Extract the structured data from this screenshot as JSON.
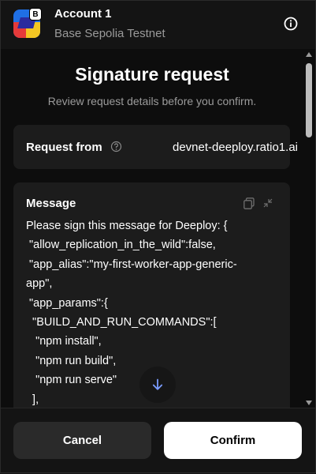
{
  "header": {
    "account_name": "Account 1",
    "network": "Base Sepolia Testnet",
    "avatar_badge": "B"
  },
  "page": {
    "title": "Signature request",
    "subtitle": "Review request details before you confirm."
  },
  "request": {
    "label": "Request from",
    "origin": "devnet-deeploy.ratio1.ai"
  },
  "message": {
    "label": "Message",
    "text": "Please sign this message for Deeploy: {\n \"allow_replication_in_the_wild\":false,\n \"app_alias\":\"my-first-worker-app-generic-\napp\",\n \"app_params\":{\n  \"BUILD_AND_RUN_COMMANDS\":[\n   \"npm install\",\n   \"npm run build\",\n   \"npm run serve\"\n  ],"
  },
  "footer": {
    "cancel_label": "Cancel",
    "confirm_label": "Confirm"
  },
  "colors": {
    "background": "#0d0d0d",
    "card": "#1c1c1c",
    "confirm_bg": "#ffffff",
    "cancel_bg": "#2a2a2a",
    "accent_arrow": "#7a9cff"
  },
  "icons": [
    "info-icon",
    "help-icon",
    "copy-icon",
    "collapse-icon",
    "arrow-down-icon"
  ]
}
